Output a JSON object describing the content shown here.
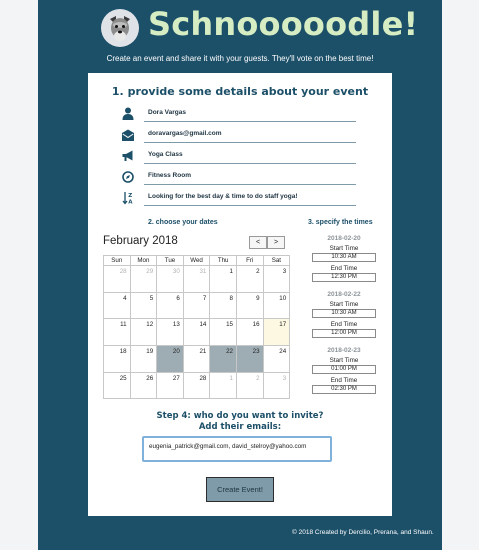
{
  "header": {
    "title": "Schnooooodle!",
    "tagline": "Create an event and share it with your guests. They'll vote on the best time!"
  },
  "step1": {
    "heading": "1. provide some details about your event",
    "fields": [
      {
        "icon": "person-icon",
        "value": "Dora Vargas"
      },
      {
        "icon": "envelope-icon",
        "value": "doravargas@gmail.com"
      },
      {
        "icon": "megaphone-icon",
        "value": "Yoga Class"
      },
      {
        "icon": "location-icon",
        "value": "Fitness Room"
      },
      {
        "icon": "sort-az-icon",
        "value": "Looking for the best day & time to do staff yoga!"
      }
    ]
  },
  "step2": {
    "heading": "2. choose your dates",
    "month": "February 2018",
    "prev": "<",
    "next": ">",
    "weekdays": [
      "Sun",
      "Mon",
      "Tue",
      "Wed",
      "Thu",
      "Fri",
      "Sat"
    ],
    "weeks": [
      [
        {
          "d": "28",
          "s": "other"
        },
        {
          "d": "29",
          "s": "other"
        },
        {
          "d": "30",
          "s": "other"
        },
        {
          "d": "31",
          "s": "other"
        },
        {
          "d": "1",
          "s": ""
        },
        {
          "d": "2",
          "s": ""
        },
        {
          "d": "3",
          "s": ""
        }
      ],
      [
        {
          "d": "4",
          "s": ""
        },
        {
          "d": "5",
          "s": ""
        },
        {
          "d": "6",
          "s": ""
        },
        {
          "d": "7",
          "s": ""
        },
        {
          "d": "8",
          "s": ""
        },
        {
          "d": "9",
          "s": ""
        },
        {
          "d": "10",
          "s": ""
        }
      ],
      [
        {
          "d": "11",
          "s": ""
        },
        {
          "d": "12",
          "s": ""
        },
        {
          "d": "13",
          "s": ""
        },
        {
          "d": "14",
          "s": ""
        },
        {
          "d": "15",
          "s": ""
        },
        {
          "d": "16",
          "s": ""
        },
        {
          "d": "17",
          "s": "today"
        }
      ],
      [
        {
          "d": "18",
          "s": ""
        },
        {
          "d": "19",
          "s": ""
        },
        {
          "d": "20",
          "s": "sel"
        },
        {
          "d": "21",
          "s": ""
        },
        {
          "d": "22",
          "s": "sel"
        },
        {
          "d": "23",
          "s": "sel"
        },
        {
          "d": "24",
          "s": ""
        }
      ],
      [
        {
          "d": "25",
          "s": ""
        },
        {
          "d": "26",
          "s": ""
        },
        {
          "d": "27",
          "s": ""
        },
        {
          "d": "28",
          "s": ""
        },
        {
          "d": "1",
          "s": "other"
        },
        {
          "d": "2",
          "s": "other"
        },
        {
          "d": "3",
          "s": "other"
        }
      ]
    ]
  },
  "step3": {
    "heading": "3. specify the times",
    "start_label": "Start Time",
    "end_label": "End Time",
    "dates": [
      {
        "date": "2018-02-20",
        "start": "10:30 AM",
        "end": "12:30 PM"
      },
      {
        "date": "2018-02-22",
        "start": "10:30 AM",
        "end": "12:00 PM"
      },
      {
        "date": "2018-02-23",
        "start": "01:00 PM",
        "end": "02:30 PM"
      }
    ]
  },
  "step4": {
    "heading": "Step 4: who do you want to invite? Add their emails:",
    "emails": "eugenia_patrick@gmail.com, david_stelroy@yahoo.com"
  },
  "actions": {
    "create": "Create Event!"
  },
  "footer": {
    "text": "© 2018 Created by Dercilio, Prerana, and Shaun."
  }
}
